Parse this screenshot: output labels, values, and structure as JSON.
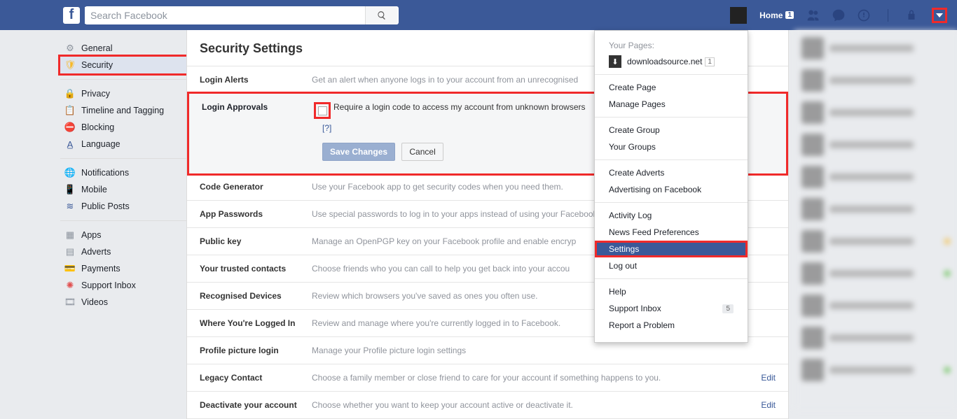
{
  "search": {
    "placeholder": "Search Facebook"
  },
  "topbar": {
    "home": "Home",
    "home_badge": "1"
  },
  "sidebar": {
    "g1": [
      {
        "id": "general",
        "label": "General"
      },
      {
        "id": "security",
        "label": "Security"
      }
    ],
    "g2": [
      {
        "id": "privacy",
        "label": "Privacy"
      },
      {
        "id": "timeline",
        "label": "Timeline and Tagging"
      },
      {
        "id": "blocking",
        "label": "Blocking"
      },
      {
        "id": "language",
        "label": "Language"
      }
    ],
    "g3": [
      {
        "id": "notifications",
        "label": "Notifications"
      },
      {
        "id": "mobile",
        "label": "Mobile"
      },
      {
        "id": "public",
        "label": "Public Posts"
      }
    ],
    "g4": [
      {
        "id": "apps",
        "label": "Apps"
      },
      {
        "id": "adverts",
        "label": "Adverts"
      },
      {
        "id": "payments",
        "label": "Payments"
      },
      {
        "id": "support",
        "label": "Support Inbox"
      },
      {
        "id": "videos",
        "label": "Videos"
      }
    ]
  },
  "main": {
    "title": "Security Settings",
    "rows": {
      "login_alerts": {
        "label": "Login Alerts",
        "desc": "Get an alert when anyone logs in to your account from an unrecognised"
      },
      "login_approvals": {
        "label": "Login Approvals",
        "desc": "Require a login code to access my account from unknown browsers",
        "help": "[?]",
        "save": "Save Changes",
        "cancel": "Cancel"
      },
      "code_gen": {
        "label": "Code Generator",
        "desc": "Use your Facebook app to get security codes when you need them."
      },
      "app_pw": {
        "label": "App Passwords",
        "desc": "Use special passwords to log in to your apps instead of using your Facebook password or Login Approvals codes."
      },
      "public_key": {
        "label": "Public key",
        "desc": "Manage an OpenPGP key on your Facebook profile and enable encryp"
      },
      "trusted": {
        "label": "Your trusted contacts",
        "desc": "Choose friends who you can call to help you get back into your accou"
      },
      "devices": {
        "label": "Recognised Devices",
        "desc": "Review which browsers you've saved as ones you often use."
      },
      "logged_in": {
        "label": "Where You're Logged In",
        "desc": "Review and manage where you're currently logged in to Facebook."
      },
      "pic_login": {
        "label": "Profile picture login",
        "desc": "Manage your Profile picture login settings"
      },
      "legacy": {
        "label": "Legacy Contact",
        "desc": "Choose a family member or close friend to care for your account if something happens to you.",
        "action": "Edit"
      },
      "deactivate": {
        "label": "Deactivate your account",
        "desc": "Choose whether you want to keep your account active or deactivate it.",
        "action": "Edit"
      }
    }
  },
  "dropdown": {
    "pages_header": "Your Pages:",
    "page": {
      "name": "downloadsource.net",
      "badge": "1"
    },
    "s1": [
      "Create Page",
      "Manage Pages"
    ],
    "s2": [
      "Create Group",
      "Your Groups"
    ],
    "s3": [
      "Create Adverts",
      "Advertising on Facebook"
    ],
    "s4": [
      "Activity Log",
      "News Feed Preferences",
      "Settings",
      "Log out"
    ],
    "s5": [
      {
        "label": "Help"
      },
      {
        "label": "Support Inbox",
        "count": "5"
      },
      {
        "label": "Report a Problem"
      }
    ]
  }
}
